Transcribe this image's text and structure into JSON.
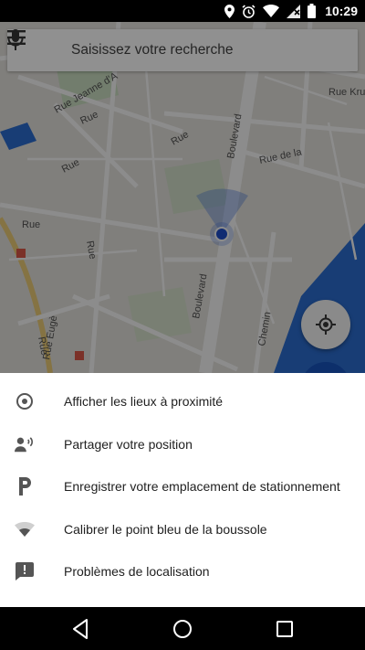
{
  "status_bar": {
    "time": "10:29",
    "icons": [
      "location-icon",
      "alarm-icon",
      "wifi-icon",
      "signal-icon",
      "battery-icon"
    ]
  },
  "search": {
    "placeholder": "Saisissez votre recherche"
  },
  "map": {
    "street_labels": [
      "Rue Jeanne d'A",
      "Rue",
      "Rue",
      "Rue",
      "Rue",
      "Boulevard",
      "Rue de la",
      "Rue Kru",
      "Rue",
      "Rue",
      "Rue Eugè",
      "Boulevard",
      "Chemin"
    ]
  },
  "sheet": {
    "items": [
      {
        "label": "Afficher les lieux à proximité",
        "icon": "target-icon"
      },
      {
        "label": "Partager votre position",
        "icon": "person-share-icon"
      },
      {
        "label": "Enregistrer votre emplacement de stationnement",
        "icon": "parking-icon"
      },
      {
        "label": "Calibrer le point bleu de la boussole",
        "icon": "calibrate-icon"
      },
      {
        "label": "Problèmes de localisation",
        "icon": "feedback-icon"
      }
    ]
  },
  "colors": {
    "accent": "#1e4fd0",
    "map_water": "#2c6fd6",
    "text_primary": "#212121"
  }
}
